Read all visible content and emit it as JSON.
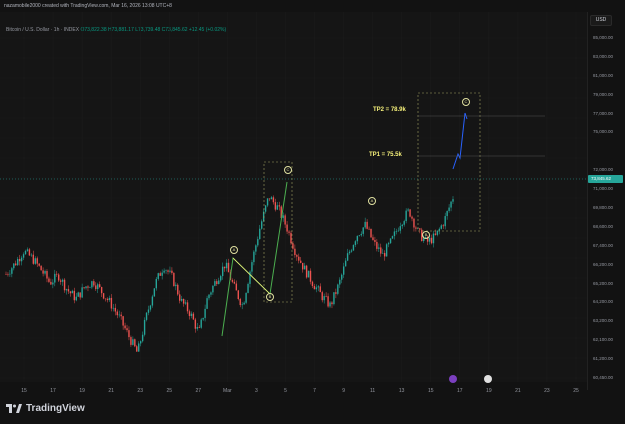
{
  "header": {
    "credit": "nazamobile2000 created with TradingView.com, Mar 16, 2026 13:08 UTC+8"
  },
  "symbol_line": {
    "symbol": "Bitcoin / U.S. Dollar · 1h · INDEX",
    "ohlc": "O73,822.38 H73,881.17 L73,739.48 C73,845.62 +12.45 (+0.02%)"
  },
  "currency": "USD",
  "current_price": "73,845.62",
  "price_axis": [
    "85,000.00",
    "83,000.00",
    "81,000.00",
    "79,000.00",
    "77,000.00",
    "75,000.00",
    "73,845.62",
    "72,000.00",
    "71,000.00",
    "69,800.00",
    "68,600.00",
    "67,400.00",
    "66,200.00",
    "65,200.00",
    "64,200.00",
    "63,200.00",
    "62,100.00",
    "61,200.00",
    "60,450.00"
  ],
  "time_axis": [
    "15",
    "17",
    "19",
    "21",
    "23",
    "25",
    "27",
    "Mar",
    "3",
    "5",
    "7",
    "9",
    "11",
    "13",
    "15",
    "17",
    "19",
    "21",
    "23",
    "25"
  ],
  "annotations": {
    "tp2": "TP2 = 78.9k",
    "tp1": "TP1 = 75.5k",
    "wave_a1": "A",
    "wave_b1": "B",
    "wave_c1": "C",
    "wave_a2": "A",
    "wave_b2": "B",
    "wave_c2": "C"
  },
  "branding": "TradingView",
  "colors": {
    "up": "#26a69a",
    "down": "#ef5350",
    "wave_green": "#4caf50",
    "wave_yellow": "#f5f07a",
    "projection_blue": "#2962ff",
    "background": "#151515"
  },
  "chart_data": {
    "type": "candlestick",
    "title": "Bitcoin / U.S. Dollar · 1h · INDEX",
    "ylim": [
      60450,
      86000
    ],
    "x": [
      "15",
      "17",
      "19",
      "21",
      "23",
      "25",
      "27",
      "Mar",
      "3",
      "5",
      "7",
      "9",
      "11",
      "13",
      "15",
      "17",
      "19",
      "21",
      "23",
      "25"
    ],
    "close_path": [
      68500,
      69200,
      70100,
      69600,
      68800,
      67900,
      68400,
      67400,
      66800,
      67600,
      68000,
      67200,
      66400,
      65400,
      64200,
      63000,
      65500,
      67800,
      69100,
      68200,
      66600,
      65800,
      64400,
      66900,
      68100,
      69200,
      67600,
      66300,
      69200,
      71800,
      73900,
      73100,
      71800,
      70100,
      68900,
      67900,
      67000,
      66300,
      67800,
      69800,
      71200,
      71900,
      70600,
      69800,
      70800,
      72100,
      72900,
      71400,
      70700,
      71100,
      72200,
      73845.62
    ],
    "current": 73845.62,
    "targets": {
      "TP1": 75500,
      "TP2": 78900
    }
  }
}
